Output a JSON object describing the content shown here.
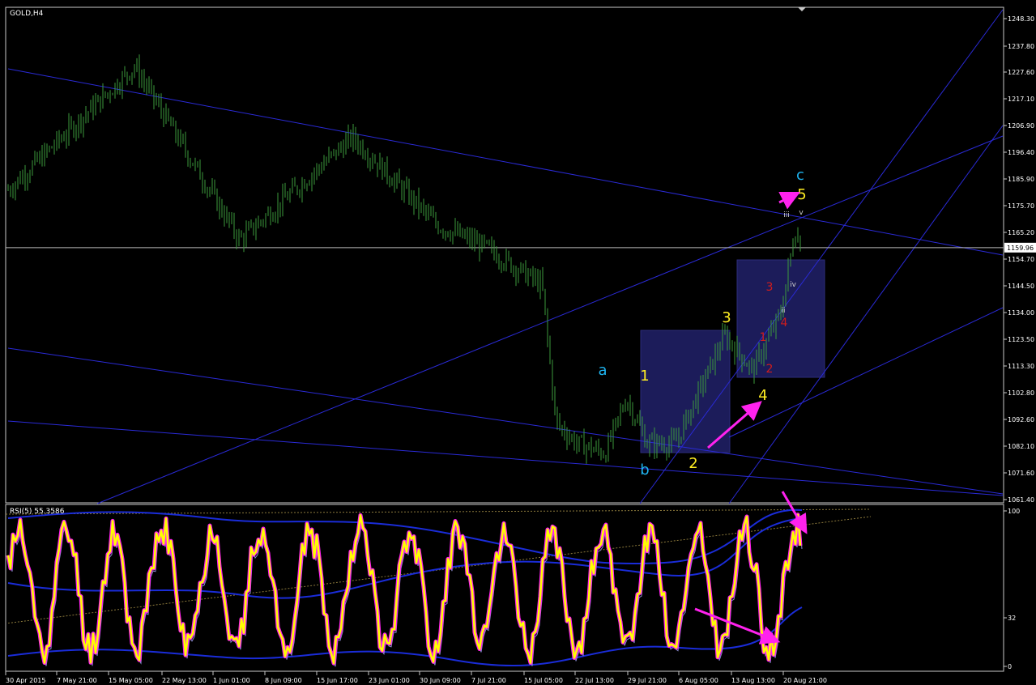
{
  "window": {
    "symbol_label": "GOLD,H4"
  },
  "colors": {
    "background": "#000000",
    "frame": "#c8c8c8",
    "candle": "#3c9a3c",
    "trendline": "#2a2ad6",
    "box_fill": "#1c1c5a",
    "bid_line": "#b8b8b8",
    "wave_yellow": "#ffee22",
    "wave_cyan": "#1eb4f0",
    "wave_red": "#d01c1c",
    "wave_white": "#d0d0d0",
    "arrow_magenta": "#ff22ee",
    "rsi_main": "#ffff00",
    "rsi_glow": "#ff22ee",
    "rsi_band": "#1a2cd8",
    "rsi_ma": "#8a8ad0",
    "rsi_level_line": "#8c7a3c"
  },
  "main_axis": {
    "ticks": [
      "1248.30",
      "1237.80",
      "1227.60",
      "1217.10",
      "1206.90",
      "1196.40",
      "1185.90",
      "1175.70",
      "1165.20",
      "1154.70",
      "1144.50",
      "1134.00",
      "1123.50",
      "1113.30",
      "1102.80",
      "1092.60",
      "1082.10",
      "1071.60",
      "1061.40"
    ],
    "current_price": "1159.96"
  },
  "time_axis": [
    "30 Apr 2015",
    "7 May 21:00",
    "15 May 05:00",
    "22 May 13:00",
    "1 Jun 01:00",
    "8 Jun 09:00",
    "15 Jun 17:00",
    "23 Jun 01:00",
    "30 Jun 09:00",
    "7 Jul 21:00",
    "15 Jul 05:00",
    "22 Jul 13:00",
    "29 Jul 21:00",
    "6 Aug 05:00",
    "13 Aug 13:00",
    "20 Aug 21:00"
  ],
  "wave_labels": [
    {
      "text": "a",
      "color": "cyan",
      "size": "large"
    },
    {
      "text": "b",
      "color": "cyan",
      "size": "large"
    },
    {
      "text": "c",
      "color": "cyan",
      "size": "large"
    },
    {
      "text": "1",
      "color": "yellow",
      "size": "large"
    },
    {
      "text": "2",
      "color": "yellow",
      "size": "large"
    },
    {
      "text": "3",
      "color": "yellow",
      "size": "large"
    },
    {
      "text": "4",
      "color": "yellow",
      "size": "large"
    },
    {
      "text": "5",
      "color": "yellow",
      "size": "large"
    },
    {
      "text": "1",
      "color": "red",
      "size": "small"
    },
    {
      "text": "2",
      "color": "red",
      "size": "small"
    },
    {
      "text": "3",
      "color": "red",
      "size": "small"
    },
    {
      "text": "4",
      "color": "red",
      "size": "small"
    },
    {
      "text": "ii",
      "color": "white",
      "size": "tiny"
    },
    {
      "text": "iii",
      "color": "white",
      "size": "tiny"
    },
    {
      "text": "iv",
      "color": "white",
      "size": "tiny"
    },
    {
      "text": "v",
      "color": "white",
      "size": "tiny"
    }
  ],
  "rsi": {
    "label": "RSI(5) 55.3586",
    "ticks": [
      "100",
      "32",
      "0"
    ]
  },
  "chart_data": [
    {
      "type": "candlestick",
      "title": "GOLD,H4",
      "ylim": [
        1058,
        1256
      ],
      "x_date_range": [
        "2015-04-30",
        "2015-08-21"
      ],
      "key_points": [
        {
          "date": "2015-04-30",
          "price": 1183
        },
        {
          "date": "2015-05-18",
          "price": 1232
        },
        {
          "date": "2015-06-02",
          "price": 1163
        },
        {
          "date": "2015-06-18",
          "price": 1204
        },
        {
          "date": "2015-06-30",
          "price": 1169
        },
        {
          "date": "2015-07-07",
          "price": 1160
        },
        {
          "date": "2015-07-15",
          "price": 1145
        },
        {
          "date": "2015-07-17",
          "price": 1090
        },
        {
          "date": "2015-07-20",
          "price": 1082
        },
        {
          "date": "2015-07-24",
          "price": 1078
        },
        {
          "date": "2015-07-27",
          "price": 1100
        },
        {
          "date": "2015-07-30",
          "price": 1082
        },
        {
          "date": "2015-08-03",
          "price": 1082
        },
        {
          "date": "2015-08-10",
          "price": 1125
        },
        {
          "date": "2015-08-14",
          "price": 1111
        },
        {
          "date": "2015-08-18",
          "price": 1134
        },
        {
          "date": "2015-08-20",
          "price": 1167
        },
        {
          "date": "2015-08-21",
          "price": 1160
        }
      ]
    },
    {
      "type": "line",
      "title": "RSI(5) 55.3586",
      "ylim": [
        0,
        100
      ],
      "levels": [
        32,
        100
      ]
    }
  ]
}
